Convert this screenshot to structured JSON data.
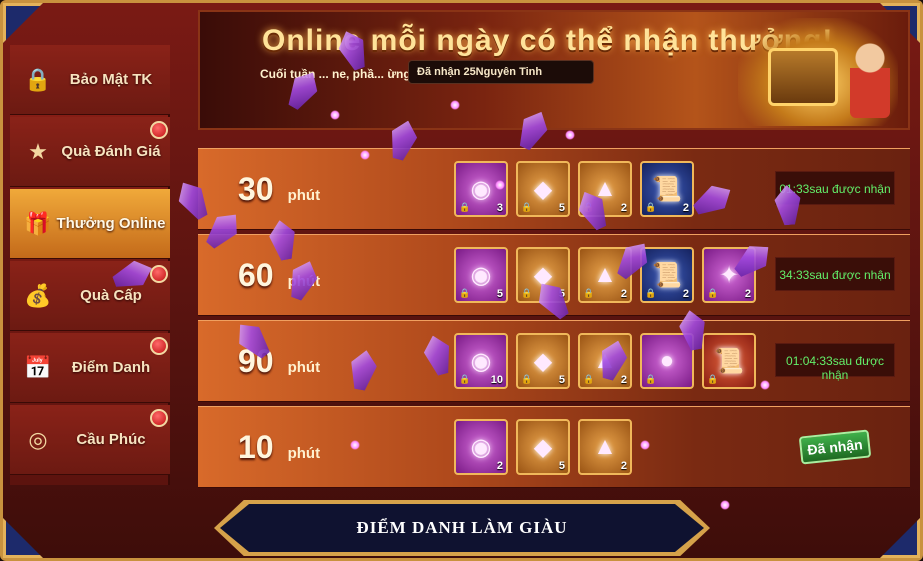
{
  "banner": {
    "title": "Online mỗi ngày   có thể nhận thưởng!",
    "subtitle": "Cuối tuần ... ne, phầ... ừng",
    "status": "Đã nhận 25Nguyên Tinh"
  },
  "sidebar": {
    "items": [
      {
        "label": "Bảo Mật TK",
        "icon": "lock-icon",
        "badge": false
      },
      {
        "label": "Quà Đánh Giá",
        "icon": "star-icon",
        "badge": true
      },
      {
        "label": "Thưởng Online",
        "icon": "gift-clock-icon",
        "badge": false,
        "active": true
      },
      {
        "label": "Quà Cấp",
        "icon": "bag-icon",
        "badge": true
      },
      {
        "label": "Điểm Danh",
        "icon": "calendar-icon",
        "badge": true
      },
      {
        "label": "Cầu Phúc",
        "icon": "swirl-icon",
        "badge": true
      }
    ]
  },
  "rows": [
    {
      "minutes": "30",
      "unit": "phút",
      "items": [
        {
          "kind": "purple-orb",
          "count": "3"
        },
        {
          "kind": "crystal",
          "count": "5"
        },
        {
          "kind": "gold-ingot",
          "count": "2"
        },
        {
          "kind": "scroll",
          "count": "2"
        }
      ],
      "status": "01:33sau được nhận"
    },
    {
      "minutes": "60",
      "unit": "phút",
      "items": [
        {
          "kind": "purple-orb",
          "count": "5"
        },
        {
          "kind": "crystal",
          "count": "5"
        },
        {
          "kind": "gold-ingot",
          "count": "2"
        },
        {
          "kind": "scroll",
          "count": "2"
        },
        {
          "kind": "gem-fragment",
          "count": "2"
        }
      ],
      "status": "34:33sau được nhận"
    },
    {
      "minutes": "90",
      "unit": "phút",
      "items": [
        {
          "kind": "purple-orb",
          "count": "10"
        },
        {
          "kind": "crystal",
          "count": "5"
        },
        {
          "kind": "gold-ingot",
          "count": "2"
        },
        {
          "kind": "treasure-coin",
          "count": ""
        },
        {
          "kind": "ancient-scroll",
          "count": ""
        }
      ],
      "status": "01:04:33sau được nhận"
    },
    {
      "minutes": "10",
      "unit": "phút",
      "items": [
        {
          "kind": "purple-orb",
          "count": "2"
        },
        {
          "kind": "crystal",
          "count": "5"
        },
        {
          "kind": "gold-ingot",
          "count": "2"
        }
      ],
      "status": "Đã nhận"
    }
  ],
  "footer": {
    "label": "ĐIỂM DANH LÀM GIÀU"
  },
  "colors": {
    "accent_gold": "#e4b25a",
    "timer_green": "#63f06a",
    "frame_red": "#7a1a14"
  }
}
